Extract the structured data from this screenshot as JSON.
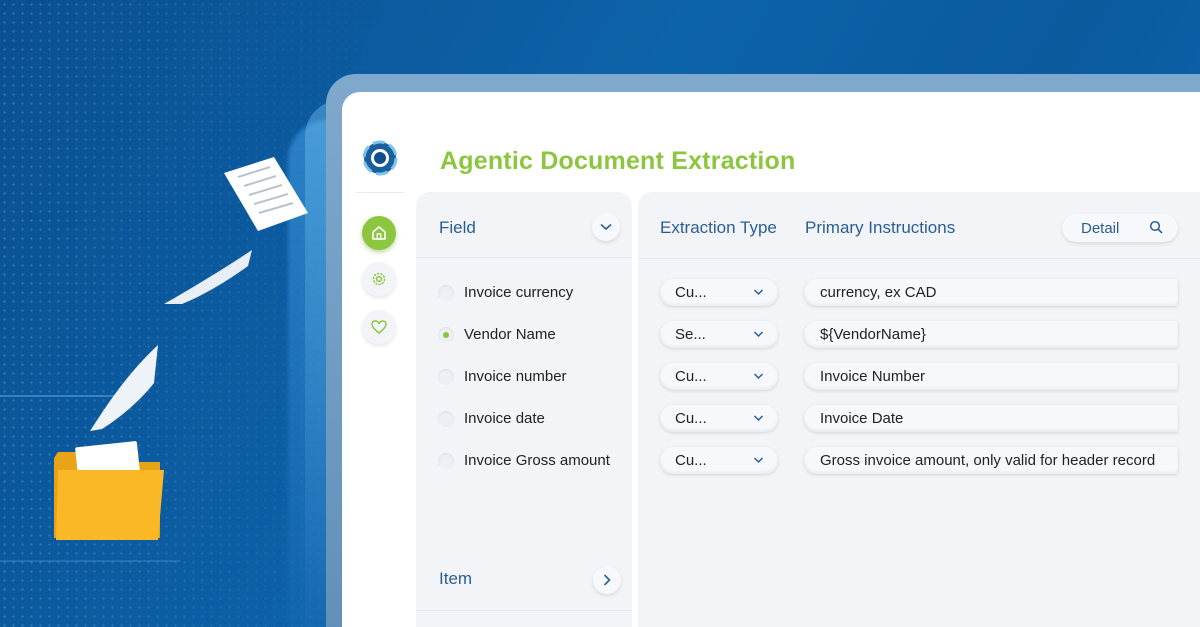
{
  "app": {
    "title": "Agentic Document Extraction"
  },
  "sidebar": {
    "items": [
      {
        "name": "home",
        "icon": "home-icon",
        "active": true
      },
      {
        "name": "settings",
        "icon": "gear-icon",
        "active": false
      },
      {
        "name": "favorites",
        "icon": "heart-icon",
        "active": false
      }
    ]
  },
  "field_panel": {
    "header": "Field",
    "rows": [
      {
        "label": "Invoice currency",
        "selected": false
      },
      {
        "label": "Vendor Name",
        "selected": true
      },
      {
        "label": "Invoice number",
        "selected": false
      },
      {
        "label": "Invoice date",
        "selected": false
      },
      {
        "label": "Invoice Gross amount",
        "selected": false
      }
    ]
  },
  "main_panel": {
    "col_extraction_type": "Extraction Type",
    "col_primary_instructions": "Primary Instructions",
    "detail_label": "Detail",
    "rows": [
      {
        "type": "Cu...",
        "instruction": "currency, ex CAD"
      },
      {
        "type": "Se...",
        "instruction": "${VendorName}"
      },
      {
        "type": "Cu...",
        "instruction": "Invoice Number"
      },
      {
        "type": "Cu...",
        "instruction": "Invoice Date"
      },
      {
        "type": "Cu...",
        "instruction": "Gross invoice amount, only valid for header record"
      }
    ]
  },
  "item_panel": {
    "header": "Item"
  },
  "colors": {
    "accent_green": "#8cc63f",
    "header_blue": "#2a5e93",
    "background_blue": "#0d63a8",
    "folder_yellow": "#fbb826"
  }
}
